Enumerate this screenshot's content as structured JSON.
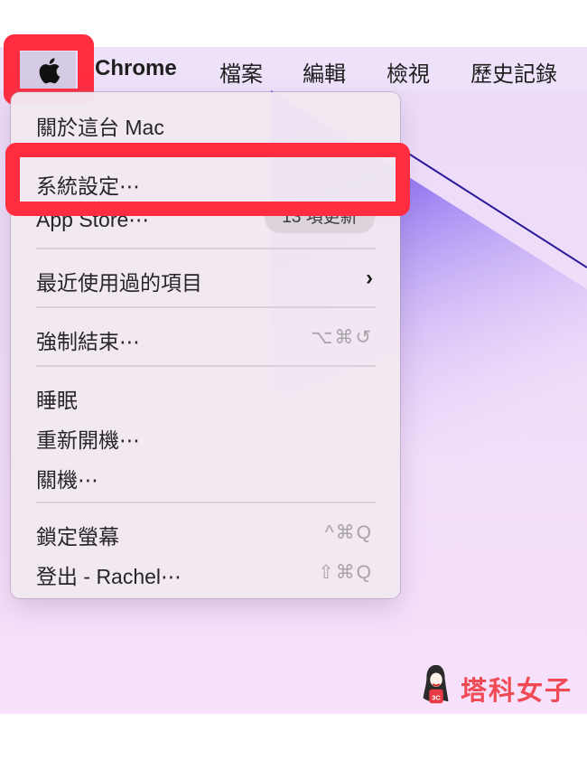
{
  "menubar": {
    "app_name": "Chrome",
    "items": [
      "檔案",
      "編輯",
      "檢視",
      "歷史記錄"
    ]
  },
  "apple_menu": {
    "items": [
      {
        "label": "關於這台 Mac"
      },
      {
        "label": "系統設定⋯"
      },
      {
        "label": "App Store⋯",
        "badge": "13 項更新"
      },
      {
        "label": "最近使用過的項目",
        "submenu": true
      },
      {
        "label": "強制結束⋯",
        "shortcut": "⌥⌘⎋"
      },
      {
        "label": "睡眠"
      },
      {
        "label": "重新開機⋯"
      },
      {
        "label": "關機⋯"
      },
      {
        "label": "鎖定螢幕",
        "shortcut": "^⌘Q"
      },
      {
        "label": "登出 - Rachel⋯",
        "shortcut": "⇧⌘Q"
      }
    ],
    "submenu_glyph": "›",
    "force_quit_shortcut_display": "⌥⌘↺",
    "lock_shortcut_display": "^⌘Q",
    "logout_shortcut_display": "⇧⌘Q"
  },
  "highlights": {
    "color": "#ff2d3f",
    "targets": [
      "apple-menu-button",
      "menu-item-system-settings"
    ]
  },
  "watermark": {
    "text": "塔科女子",
    "shirt_text": "3C",
    "color": "#f04a55"
  }
}
